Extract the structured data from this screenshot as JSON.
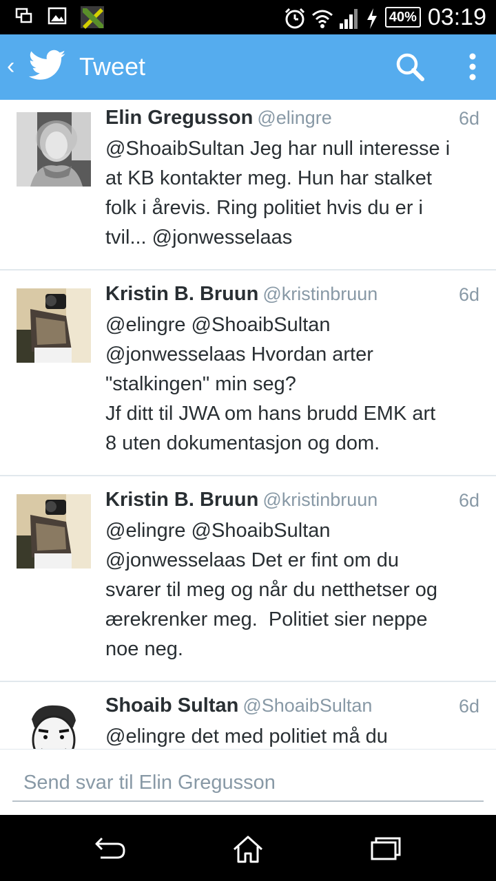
{
  "status_bar": {
    "battery": "40%",
    "time": "03:19"
  },
  "action_bar": {
    "back_glyph": "‹",
    "title": "Tweet"
  },
  "tweets": [
    {
      "name": "Elin Gregusson",
      "handle": "@elingre",
      "time": "6d",
      "text": "@ShoaibSultan Jeg har null interesse i\nat KB kontakter meg. Hun har stalket\nfolk i årevis. Ring politiet hvis du er i\ntvil... @jonwesselaas"
    },
    {
      "name": "Kristin B. Bruun",
      "handle": "@kristinbruun",
      "time": "6d",
      "text": "@elingre @ShoaibSultan\n@jonwesselaas Hvordan arter\n\"stalkingen\" min seg?\nJf ditt til JWA om hans brudd EMK art\n8 uten dokumentasjon og dom."
    },
    {
      "name": "Kristin B. Bruun",
      "handle": "@kristinbruun",
      "time": "6d",
      "text": "@elingre @ShoaibSultan\n@jonwesselaas Det er fint om du\nsvarer til meg og når du netthetser og\nærekrenker meg.  Politiet sier neppe\nnoe neg."
    },
    {
      "name": "Shoaib Sultan",
      "handle": "@ShoaibSultan",
      "time": "6d",
      "text": "@elingre det med politiet må du"
    }
  ],
  "reply": {
    "placeholder": "Send svar til Elin Gregusson"
  },
  "colors": {
    "brand": "#55acee",
    "text": "#292f33",
    "muted": "#8899a6"
  }
}
